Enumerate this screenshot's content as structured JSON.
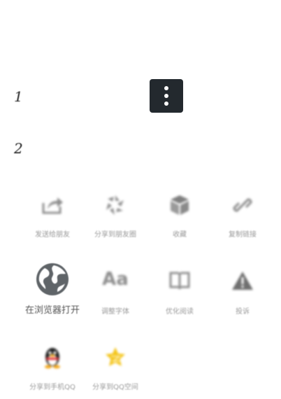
{
  "steps": [
    "1",
    "2"
  ],
  "more_button": {
    "icon": "more-vertical-icon"
  },
  "share_menu": {
    "rows": [
      [
        {
          "label": "发送给朋友",
          "icon": "forward-icon"
        },
        {
          "label": "分享到朋友圈",
          "icon": "moments-icon"
        },
        {
          "label": "收藏",
          "icon": "favorite-cube-icon"
        },
        {
          "label": "复制链接",
          "icon": "link-icon"
        }
      ],
      [
        {
          "label": "在浏览器打开",
          "icon": "globe-icon"
        },
        {
          "label": "调整字体",
          "icon": "font-size-icon"
        },
        {
          "label": "优化阅读",
          "icon": "book-icon"
        },
        {
          "label": "投诉",
          "icon": "warning-icon"
        }
      ],
      [
        {
          "label": "分享到手机QQ",
          "icon": "qq-penguin-icon"
        },
        {
          "label": "分享到QQ空间",
          "icon": "qzone-star-icon"
        }
      ]
    ]
  },
  "colors": {
    "icon_gray": "#8f8f8f",
    "globe_gray": "#5f6468",
    "button_dark": "#23292e",
    "qzone_yellow": "#f4c51c"
  }
}
